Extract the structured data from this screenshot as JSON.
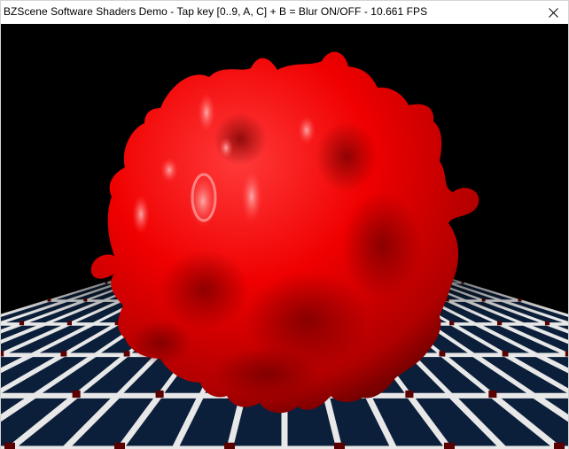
{
  "window": {
    "title": "BZScene Software Shaders Demo - Tap key [0..9, A, C] + B = Blur ON/OFF - 10.661 FPS",
    "close_icon": "close-icon"
  },
  "scene": {
    "background_color": "#000000",
    "blob_color": "#ff0000",
    "floor_tile_color": "#0b1f3a",
    "floor_line_color": "#e8e8e8",
    "floor_accent_color": "#5a0000"
  }
}
